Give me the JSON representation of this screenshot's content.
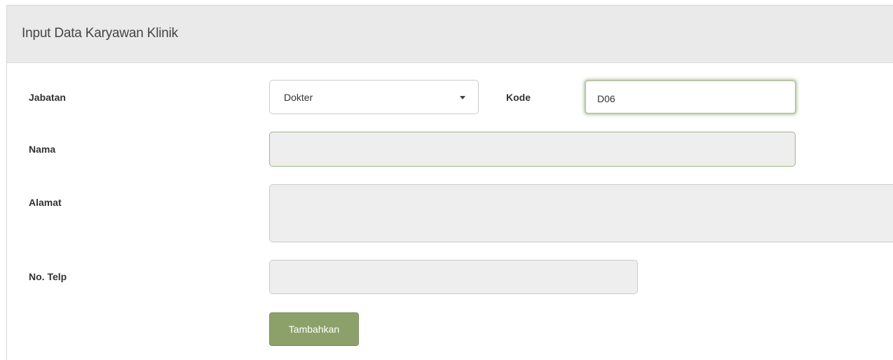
{
  "panel": {
    "title": "Input Data Karyawan Klinik"
  },
  "form": {
    "jabatan": {
      "label": "Jabatan",
      "selected": "Dokter"
    },
    "kode": {
      "label": "Kode",
      "value": "D06"
    },
    "nama": {
      "label": "Nama",
      "value": ""
    },
    "alamat": {
      "label": "Alamat",
      "value": ""
    },
    "telp": {
      "label": "No. Telp",
      "value": ""
    },
    "submit_label": "Tambahkan"
  },
  "colors": {
    "button": "#8ca16a",
    "focus_border": "#9fb48a",
    "heading_bg": "#eaeaea"
  }
}
